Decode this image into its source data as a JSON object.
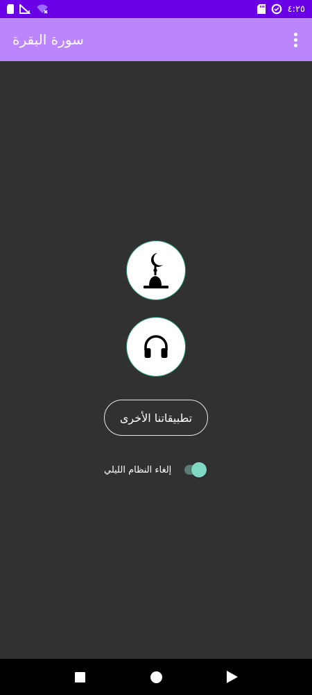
{
  "status_bar": {
    "time": "٤:٢٥",
    "left_icons": [
      "sim-card-icon",
      "signal-icon",
      "wifi-off-icon"
    ],
    "right_icons": [
      "sd-card-icon",
      "data-saver-icon"
    ]
  },
  "app_bar": {
    "title": "سورة البقرة",
    "menu_icon": "overflow-menu-icon"
  },
  "main": {
    "mosque_button_icon": "mosque-icon",
    "audio_button_icon": "headphones-icon",
    "other_apps_label": "تطبيقاتنا الأخرى",
    "night_mode_label": "إلغاء النظام الليلي",
    "night_mode_enabled": true
  },
  "nav_bar": {
    "icons": [
      "recent-apps-icon",
      "home-icon",
      "back-icon"
    ]
  },
  "colors": {
    "status_bar": "#6a00e6",
    "app_bar": "#bb86fc",
    "background": "#323132",
    "switch_accent": "#7fd7c4",
    "circle_border": "#1d8f72"
  }
}
